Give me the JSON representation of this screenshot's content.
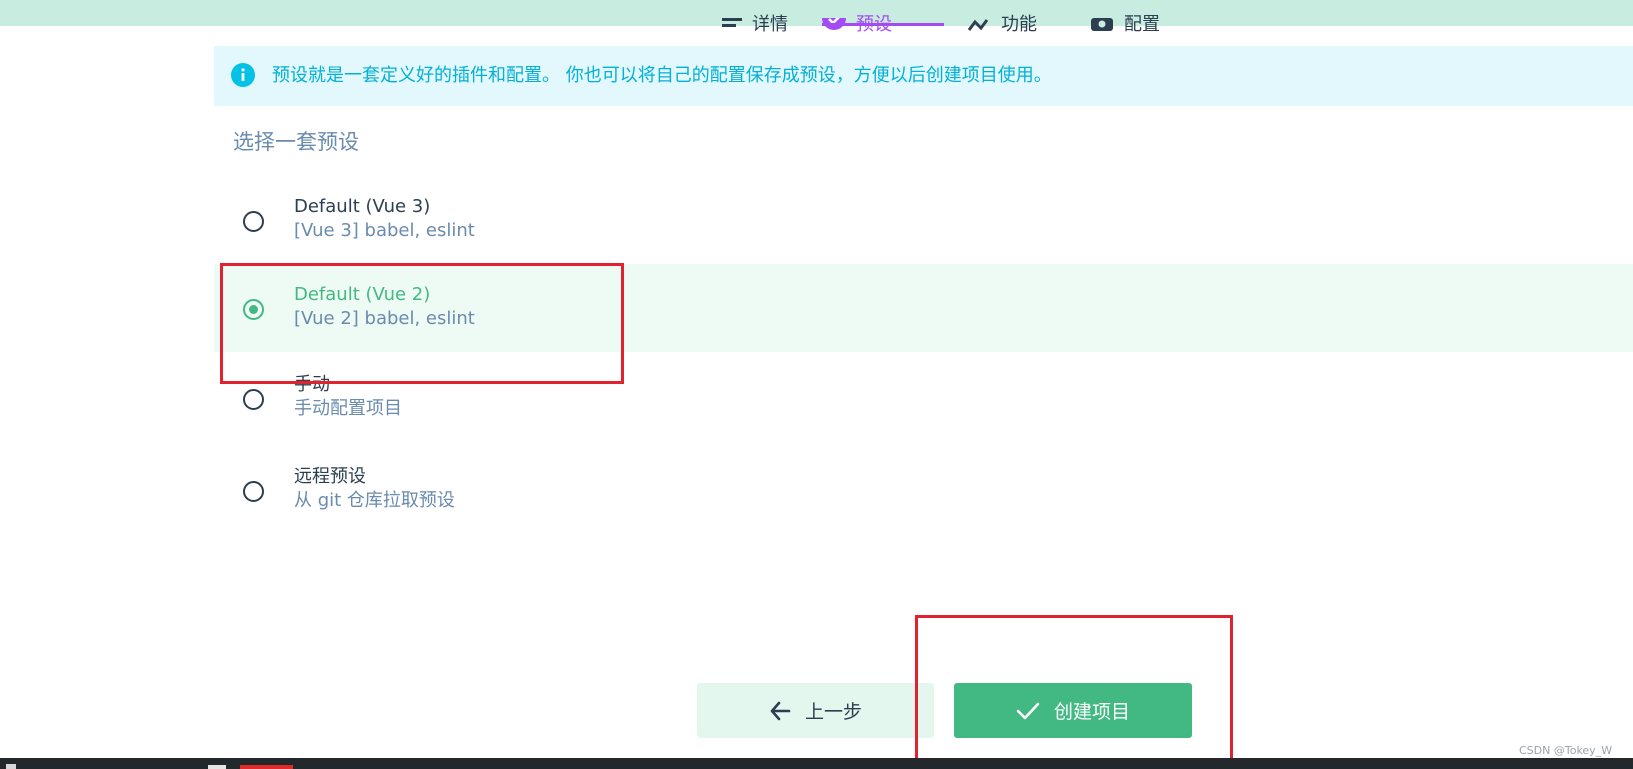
{
  "tabs": {
    "details": "详情",
    "presets": "预设",
    "features": "功能",
    "config": "配置"
  },
  "info": {
    "text": "预设就是一套定义好的插件和配置。 你也可以将自己的配置保存成预设，方便以后创建项目使用。"
  },
  "section_title": "选择一套预设",
  "presets": [
    {
      "name": "Default (Vue 3)",
      "desc": "[Vue 3] babel, eslint",
      "selected": false
    },
    {
      "name": "Default (Vue 2)",
      "desc": "[Vue 2] babel, eslint",
      "selected": true
    },
    {
      "name": "手动",
      "desc": "手动配置项目",
      "selected": false
    },
    {
      "name": "远程预设",
      "desc": "从 git 仓库拉取预设",
      "selected": false
    }
  ],
  "buttons": {
    "prev": "上一步",
    "create": "创建项目"
  },
  "watermark": "CSDN @Tokey_W",
  "colors": {
    "accent_green": "#42b983",
    "tab_active_purple": "#a44cf4",
    "info_blue": "#03c2e6",
    "annotation_red": "#e0232f"
  }
}
